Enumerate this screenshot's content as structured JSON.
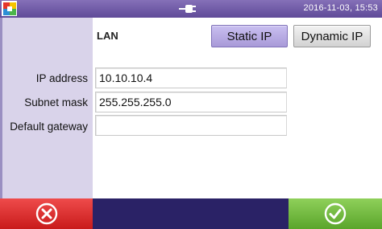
{
  "status_bar": {
    "datetime": "2016-11-03, 15:53",
    "logo_icon": "app-logo-icon",
    "power_icon": "ac-power-plug-icon"
  },
  "network": {
    "section_title": "LAN",
    "mode_buttons": {
      "static_label": "Static IP",
      "dynamic_label": "Dynamic IP",
      "selected": "Static IP"
    },
    "fields": [
      {
        "label": "IP address",
        "value": "10.10.10.4"
      },
      {
        "label": "Subnet mask",
        "value": "255.255.255.0"
      },
      {
        "label": "Default gateway",
        "value": ""
      }
    ]
  },
  "actions": {
    "cancel_icon": "cancel-x-icon",
    "confirm_icon": "confirm-check-icon"
  },
  "colors": {
    "status_bar": "#6f5aa8",
    "side_panel": "#d9d3ea",
    "selected_button": "#b3a6e0",
    "bottom_bar": "#2a2266",
    "cancel": "#d92a2a",
    "confirm": "#6fb83c"
  }
}
